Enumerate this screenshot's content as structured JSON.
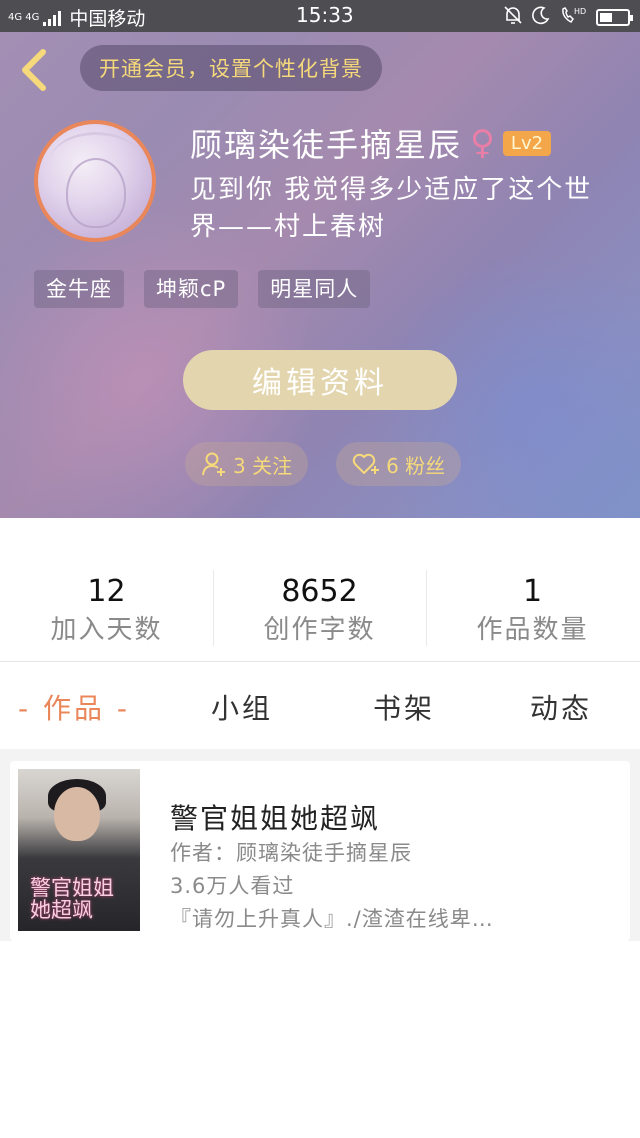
{
  "status_bar": {
    "network": "4G 4G",
    "carrier": "中国移动",
    "time": "15:33",
    "icons": [
      "bell-muted-icon",
      "moon-icon",
      "hd-call-icon",
      "battery-icon"
    ],
    "battery_level": 0.45
  },
  "header": {
    "back_icon": "chevron-left-icon",
    "vip_banner": "开通会员，设置个性化背景"
  },
  "profile": {
    "nickname": "顾璃染徒手摘星辰",
    "gender_symbol": "♀",
    "level": "Lv2",
    "signature": "见到你 我觉得多少适应了这个世界——村上春树",
    "tags": [
      "金牛座",
      "坤颖cP",
      "明星同人"
    ],
    "edit_button": "编辑资料",
    "follow": "3 关注",
    "fans": "6 粉丝"
  },
  "stats": [
    {
      "value": "12",
      "label": "加入天数"
    },
    {
      "value": "8652",
      "label": "创作字数"
    },
    {
      "value": "1",
      "label": "作品数量"
    }
  ],
  "tabs": [
    "- 作品 -",
    "小组",
    "书架",
    "动态"
  ],
  "works": [
    {
      "title": "警官姐姐她超飒",
      "author": "作者：顾璃染徒手摘星辰",
      "views": "3.6万人看过",
      "summary": "『请勿上升真人』./渣渣在线卑…",
      "cover_art_text": "警官姐姐她超飒"
    }
  ],
  "colors": {
    "accent": "#e9875b",
    "gold": "#f5d97a",
    "edit_button": "#e3d6ae",
    "level_badge": "#f3a64a"
  }
}
